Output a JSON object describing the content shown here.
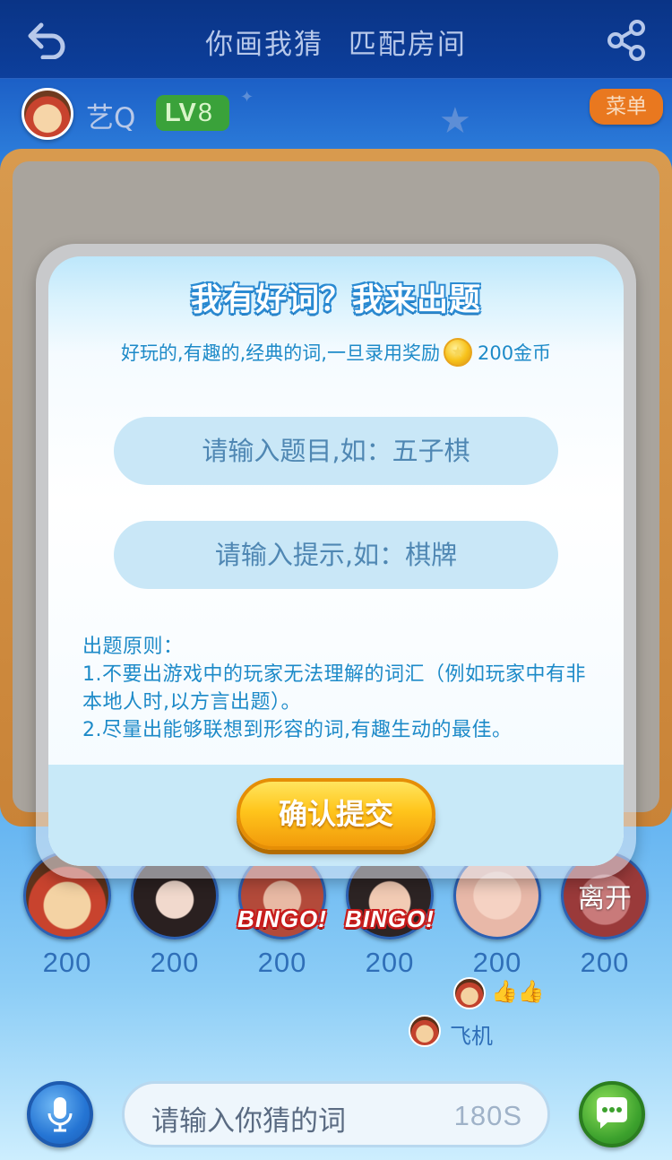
{
  "topbar": {
    "title": "你画我猜  匹配房间",
    "back_icon": "back-arrow-icon",
    "share_icon": "share-icon"
  },
  "user": {
    "name": "艺Q",
    "level_prefix": "LV",
    "level_num": "8"
  },
  "menu": {
    "label": "菜单"
  },
  "modal": {
    "title": "我有好词？我来出题",
    "subtitle_prefix": "好玩的,有趣的,经典的词,一旦录用奖励",
    "reward": "200金币",
    "topic_placeholder": "请输入题目,如：五子棋",
    "hint_placeholder": "请输入提示,如：棋牌",
    "rules_title": "出题原则：",
    "rule_1": "1.不要出游戏中的玩家无法理解的词汇（例如玩家中有非本地人时,以方言出题）。",
    "rule_2": "2.尽量出能够联想到形容的词,有趣生动的最佳。",
    "confirm_label": "确认提交"
  },
  "players": [
    {
      "score": "200",
      "bingo": ""
    },
    {
      "score": "200",
      "bingo": ""
    },
    {
      "score": "200",
      "bingo": "BINGO!"
    },
    {
      "score": "200",
      "bingo": "BINGO!"
    },
    {
      "score": "200",
      "bingo": ""
    },
    {
      "score": "200",
      "bingo": "",
      "status": "离开"
    }
  ],
  "feedback": {
    "plane_label": "飞机"
  },
  "input": {
    "placeholder": "请输入你猜的词",
    "timer": "180S"
  },
  "colors": {
    "accent_blue": "#1d8ac8",
    "confirm_gold": "#ffc51c",
    "level_green": "#3aa23a",
    "menu_orange": "#e9781f"
  }
}
